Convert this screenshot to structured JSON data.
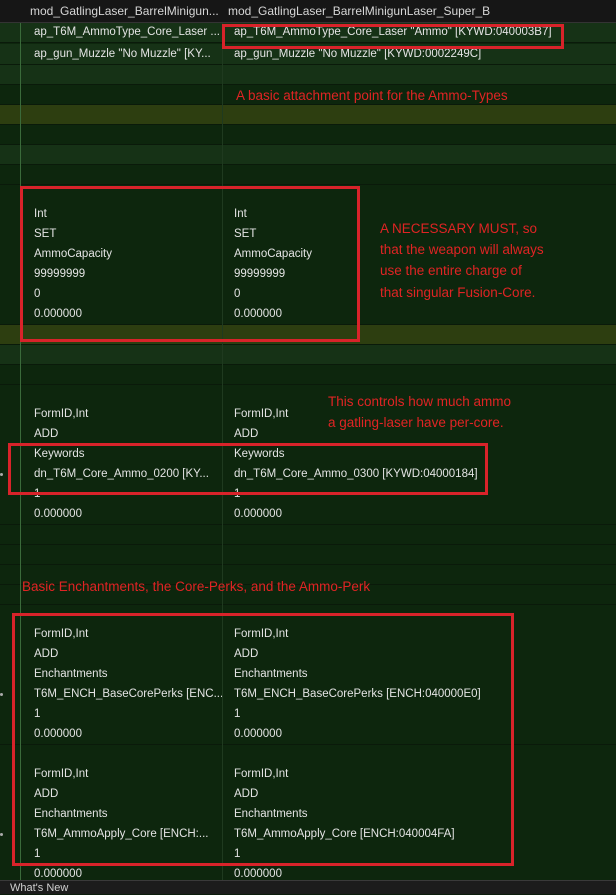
{
  "header": {
    "col1": "mod_GatlingLaser_BarrelMinigun...",
    "col2": "mod_GatlingLaser_BarrelMinigunLaser_Super_B"
  },
  "rows": [
    {
      "c1": "ap_T6M_AmmoType_Core_Laser ...",
      "c2": "ap_T6M_AmmoType_Core_Laser \"Ammo\" [KYWD:040003B7]"
    },
    {
      "c1": "ap_gun_Muzzle \"No Muzzle\" [KY...",
      "c2": "ap_gun_Muzzle \"No Muzzle\" [KYWD:0002249C]"
    },
    {
      "c1": "Int",
      "c2": "Int"
    },
    {
      "c1": "SET",
      "c2": "SET"
    },
    {
      "c1": "AmmoCapacity",
      "c2": "AmmoCapacity"
    },
    {
      "c1": "99999999",
      "c2": "99999999"
    },
    {
      "c1": "0",
      "c2": "0"
    },
    {
      "c1": "0.000000",
      "c2": "0.000000"
    },
    {
      "c1": "FormID,Int",
      "c2": "FormID,Int"
    },
    {
      "c1": "ADD",
      "c2": "ADD"
    },
    {
      "c1": "Keywords",
      "c2": "Keywords"
    },
    {
      "c1": "dn_T6M_Core_Ammo_0200 [KY...",
      "c2": "dn_T6M_Core_Ammo_0300 [KYWD:04000184]"
    },
    {
      "c1": "1",
      "c2": "1"
    },
    {
      "c1": "0.000000",
      "c2": "0.000000"
    },
    {
      "c1": "FormID,Int",
      "c2": "FormID,Int"
    },
    {
      "c1": "ADD",
      "c2": "ADD"
    },
    {
      "c1": "Enchantments",
      "c2": "Enchantments"
    },
    {
      "c1": "T6M_ENCH_BaseCorePerks [ENC...",
      "c2": "T6M_ENCH_BaseCorePerks [ENCH:040000E0]"
    },
    {
      "c1": "1",
      "c2": "1"
    },
    {
      "c1": "0.000000",
      "c2": "0.000000"
    },
    {
      "c1": "FormID,Int",
      "c2": "FormID,Int"
    },
    {
      "c1": "ADD",
      "c2": "ADD"
    },
    {
      "c1": "Enchantments",
      "c2": "Enchantments"
    },
    {
      "c1": "T6M_AmmoApply_Core [ENCH:...",
      "c2": "T6M_AmmoApply_Core [ENCH:040004FA]"
    },
    {
      "c1": "1",
      "c2": "1"
    },
    {
      "c1": "0.000000",
      "c2": "0.000000"
    }
  ],
  "annotations": {
    "ammo_types": "A basic attachment point for the Ammo-Types",
    "necessary_line1": "A NECESSARY MUST, so",
    "necessary_line2": "that the weapon will always",
    "necessary_line3": "use the entire charge of",
    "necessary_line4": "that singular Fusion-Core.",
    "controls_line1": "This controls how much ammo",
    "controls_line2": "a gatling-laser have per-core.",
    "enchantments": "Basic Enchantments, the Core-Perks, and the Ammo-Perk"
  },
  "status_bar": {
    "label": "What's New"
  },
  "colors": {
    "row_dark": "#0d260d",
    "row_highlight": "#2d3e10",
    "row_mid": "#163216",
    "annotation_red": "#e02424"
  }
}
